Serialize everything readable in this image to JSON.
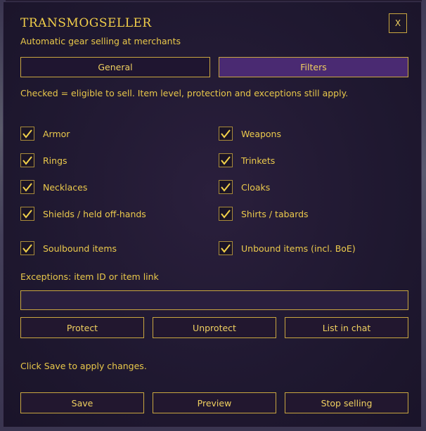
{
  "header": {
    "title": "TRANSMOGSELLER",
    "subtitle": "Automatic gear selling at merchants",
    "close_label": "X"
  },
  "tabs": [
    {
      "label": "General",
      "active": false
    },
    {
      "label": "Filters",
      "active": true
    }
  ],
  "filters": {
    "note": "Checked = eligible to sell. Item level, protection and exceptions still apply.",
    "items": [
      {
        "label": "Armor",
        "checked": true
      },
      {
        "label": "Weapons",
        "checked": true
      },
      {
        "label": "Rings",
        "checked": true
      },
      {
        "label": "Trinkets",
        "checked": true
      },
      {
        "label": "Necklaces",
        "checked": true
      },
      {
        "label": "Cloaks",
        "checked": true
      },
      {
        "label": "Shields / held off-hands",
        "checked": true
      },
      {
        "label": "Shirts / tabards",
        "checked": true
      },
      {
        "label": "Soulbound items",
        "checked": true
      },
      {
        "label": "Unbound items (incl. BoE)",
        "checked": true
      }
    ]
  },
  "exceptions": {
    "label": "Exceptions: item ID or item link",
    "value": "",
    "placeholder": "",
    "buttons": {
      "protect": "Protect",
      "unprotect": "Unprotect",
      "list": "List in chat"
    }
  },
  "footer": {
    "hint": "Click Save to apply changes.",
    "save": "Save",
    "preview": "Preview",
    "stop": "Stop selling"
  },
  "colors": {
    "gold": "#f0d060",
    "panel": "#1f1830",
    "active_tab": "#4a2a72",
    "border": "#c9a640"
  },
  "icons": {
    "checkbox": "checkmark-icon"
  }
}
